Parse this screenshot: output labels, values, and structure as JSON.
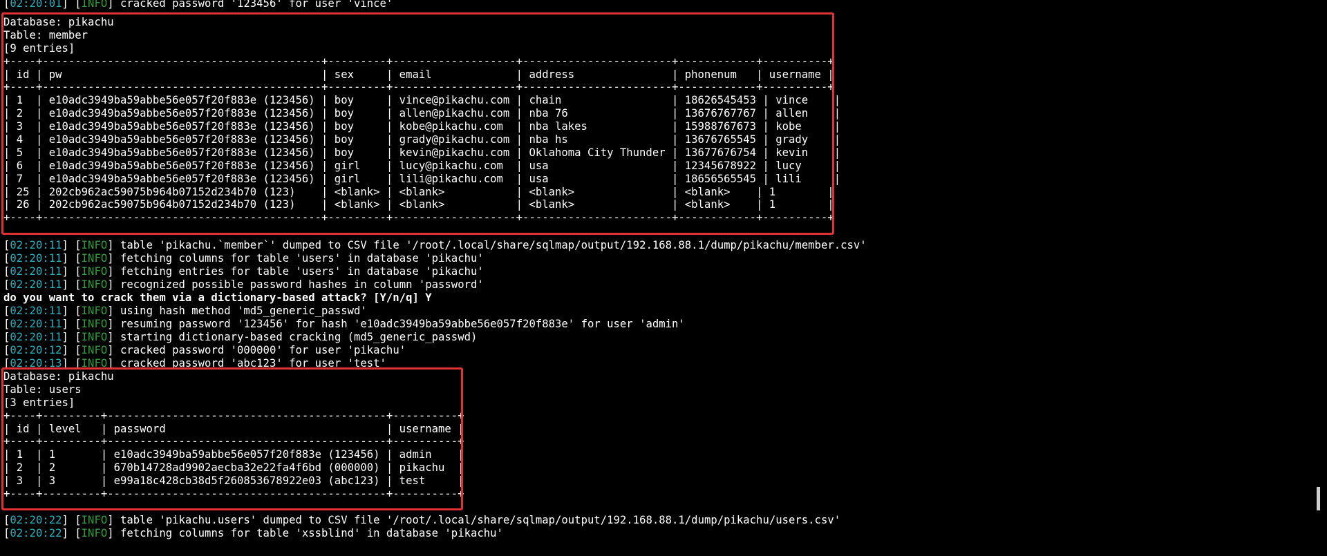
{
  "colors": {
    "background": "#000000",
    "text": "#ffffff",
    "timestamp": "#22b2c0",
    "info_level": "#2f9e3a",
    "highlight_box": "#e03232"
  },
  "terminal": {
    "line_top_partial": {
      "ts": "02:20:01",
      "level": "INFO",
      "msg": "] cracked password '123456' for user 'vince'"
    },
    "member_dump": {
      "header_lines": [
        "Database: pikachu",
        "Table: member",
        "[9 entries]"
      ],
      "table_lines": [
        "+----+-------------------------------------------+---------+-------------------+-----------------------+------------+----------+",
        "| id | pw                                        | sex     | email             | address               | phonenum   | username |",
        "+----+-------------------------------------------+---------+-------------------+-----------------------+------------+----------+",
        "| 1  | e10adc3949ba59abbe56e057f20f883e (123456) | boy     | vince@pikachu.com | chain                 | 18626545453 | vince    |",
        "| 2  | e10adc3949ba59abbe56e057f20f883e (123456) | boy     | allen@pikachu.com | nba 76                | 13676767767 | allen    |",
        "| 3  | e10adc3949ba59abbe56e057f20f883e (123456) | boy     | kobe@pikachu.com  | nba lakes             | 15988767673 | kobe     |",
        "| 4  | e10adc3949ba59abbe56e057f20f883e (123456) | boy     | grady@pikachu.com | nba hs                | 13676765545 | grady    |",
        "| 5  | e10adc3949ba59abbe56e057f20f883e (123456) | boy     | kevin@pikachu.com | Oklahoma City Thunder | 13677676754 | kevin    |",
        "| 6  | e10adc3949ba59abbe56e057f20f883e (123456) | girl    | lucy@pikachu.com  | usa                   | 12345678922 | lucy     |",
        "| 7  | e10adc3949ba59abbe56e057f20f883e (123456) | girl    | lili@pikachu.com  | usa                   | 18656565545 | lili     |",
        "| 25 | 202cb962ac59075b964b07152d234b70 (123)    | <blank> | <blank>           | <blank>               | <blank>    | 1        |",
        "| 26 | 202cb962ac59075b964b07152d234b70 (123)    | <blank> | <blank>           | <blank>               | <blank>    | 1        |",
        "+----+-------------------------------------------+---------+-------------------+-----------------------+------------+----------+"
      ]
    },
    "log_block_1": [
      {
        "ts": "02:20:11",
        "level": "INFO",
        "msg": "] table 'pikachu.`member`' dumped to CSV file '/root/.local/share/sqlmap/output/192.168.88.1/dump/pikachu/member.csv'"
      },
      {
        "ts": "02:20:11",
        "level": "INFO",
        "msg": "] fetching columns for table 'users' in database 'pikachu'"
      },
      {
        "ts": "02:20:11",
        "level": "INFO",
        "msg": "] fetching entries for table 'users' in database 'pikachu'"
      },
      {
        "ts": "02:20:11",
        "level": "INFO",
        "msg": "] recognized possible password hashes in column 'password'"
      }
    ],
    "prompt_line": "do you want to crack them via a dictionary-based attack? [Y/n/q] Y",
    "log_block_2": [
      {
        "ts": "02:20:11",
        "level": "INFO",
        "msg": "] using hash method 'md5_generic_passwd'"
      },
      {
        "ts": "02:20:11",
        "level": "INFO",
        "msg": "] resuming password '123456' for hash 'e10adc3949ba59abbe56e057f20f883e' for user 'admin'"
      },
      {
        "ts": "02:20:11",
        "level": "INFO",
        "msg": "] starting dictionary-based cracking (md5_generic_passwd)"
      },
      {
        "ts": "02:20:12",
        "level": "INFO",
        "msg": "] cracked password '000000' for user 'pikachu'"
      },
      {
        "ts": "02:20:13",
        "level": "INFO",
        "msg": "] cracked password 'abc123' for user 'test'"
      }
    ],
    "users_dump": {
      "header_lines": [
        "Database: pikachu",
        "Table: users",
        "[3 entries]"
      ],
      "table_lines": [
        "+----+---------+-------------------------------------------+----------+",
        "| id | level   | password                                  | username |",
        "+----+---------+-------------------------------------------+----------+",
        "| 1  | 1       | e10adc3949ba59abbe56e057f20f883e (123456) | admin    |",
        "| 2  | 2       | 670b14728ad9902aecba32e22fa4f6bd (000000) | pikachu  |",
        "| 3  | 3       | e99a18c428cb38d5f260853678922e03 (abc123) | test     |",
        "+----+---------+-------------------------------------------+----------+"
      ]
    },
    "log_block_3": [
      {
        "ts": "02:20:22",
        "level": "INFO",
        "msg": "] table 'pikachu.users' dumped to CSV file '/root/.local/share/sqlmap/output/192.168.88.1/dump/pikachu/users.csv'"
      },
      {
        "ts": "02:20:22",
        "level": "INFO",
        "msg": "] fetching columns for table 'xssblind' in database 'pikachu'"
      }
    ]
  }
}
